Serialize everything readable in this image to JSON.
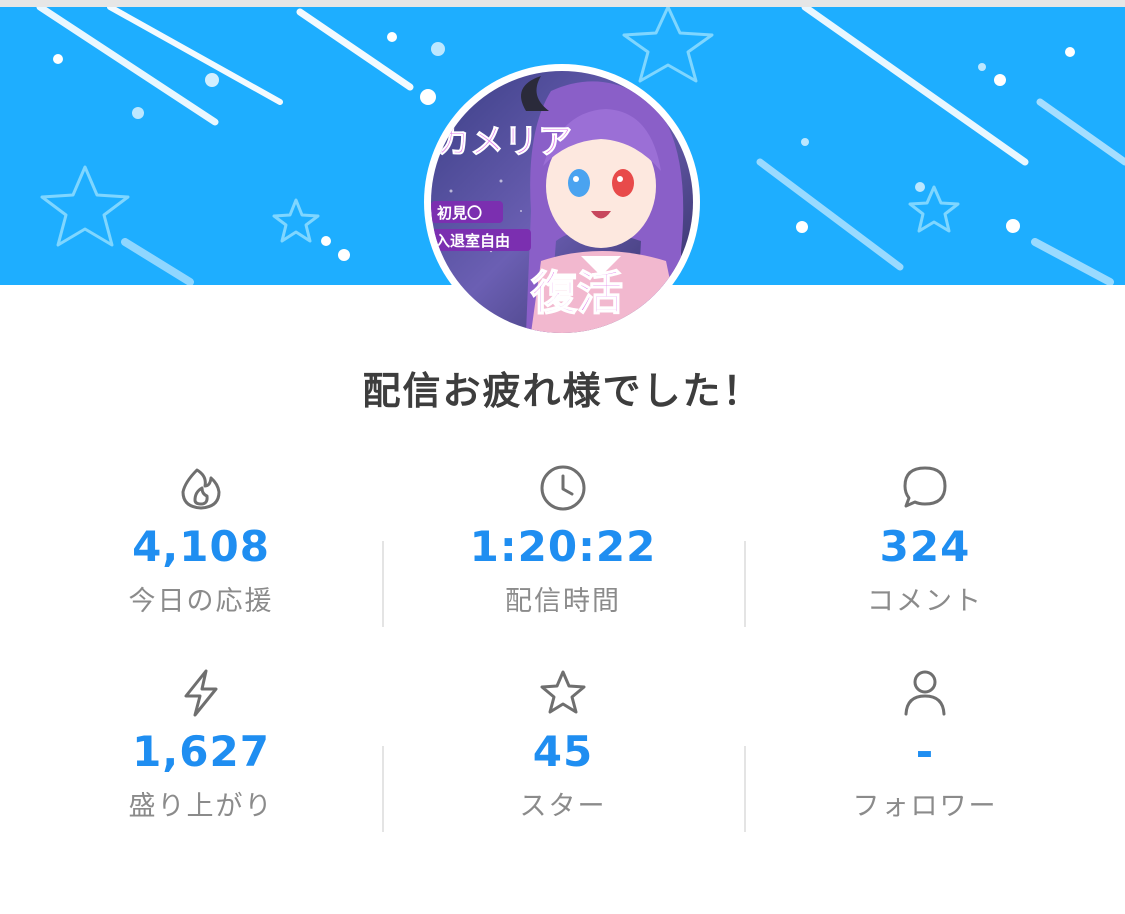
{
  "colors": {
    "banner": "#1eaeff",
    "stat_value": "#1f8ef1",
    "stat_label": "#8b8b8b",
    "headline": "#3d3d3d",
    "icon": "#6f6f6f"
  },
  "headline": "配信お疲れ様でした！",
  "avatar": {
    "overlay_texts": [
      "カメリア",
      "初見〇",
      "入退室自由",
      "復活"
    ]
  },
  "stats": [
    {
      "icon": "flame-icon",
      "value": "4,108",
      "label": "今日の応援"
    },
    {
      "icon": "clock-icon",
      "value": "1:20:22",
      "label": "配信時間"
    },
    {
      "icon": "comment-icon",
      "value": "324",
      "label": "コメント"
    },
    {
      "icon": "lightning-icon",
      "value": "1,627",
      "label": "盛り上がり"
    },
    {
      "icon": "star-icon",
      "value": "45",
      "label": "スター"
    },
    {
      "icon": "person-icon",
      "value": "-",
      "label": "フォロワー"
    }
  ]
}
